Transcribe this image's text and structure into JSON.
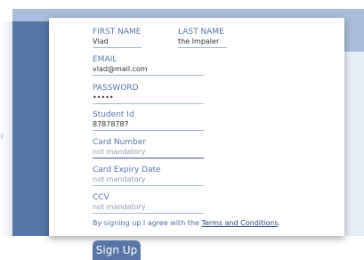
{
  "left_panel": {
    "clipped_text": "y"
  },
  "form": {
    "first_name": {
      "label": "FIRST NAME",
      "value": "Vlad"
    },
    "last_name": {
      "label": "LAST NAME",
      "value": "the Impaler"
    },
    "email": {
      "label": "EMAIL",
      "value": "vlad@mail.com"
    },
    "password": {
      "label": "PASSWORD",
      "value": "•••••"
    },
    "student_id": {
      "label": "Student Id",
      "value": "87878787"
    },
    "card_number": {
      "label": "Card Number",
      "placeholder": "not mandatory"
    },
    "card_expiry": {
      "label": "Card Expiry Date",
      "placeholder": "not mandatory"
    },
    "ccv": {
      "label": "CCV",
      "placeholder": "not mandatory"
    },
    "consent": {
      "prefix": "By signing up I agree with the ",
      "link": "Terms and Conditions",
      "suffix": "."
    }
  },
  "signup_button": {
    "label": "Sign Up"
  },
  "colors": {
    "panel": "#5477a7",
    "band": "#a9bedc",
    "label": "#5577a8",
    "button": "#5877a8"
  }
}
